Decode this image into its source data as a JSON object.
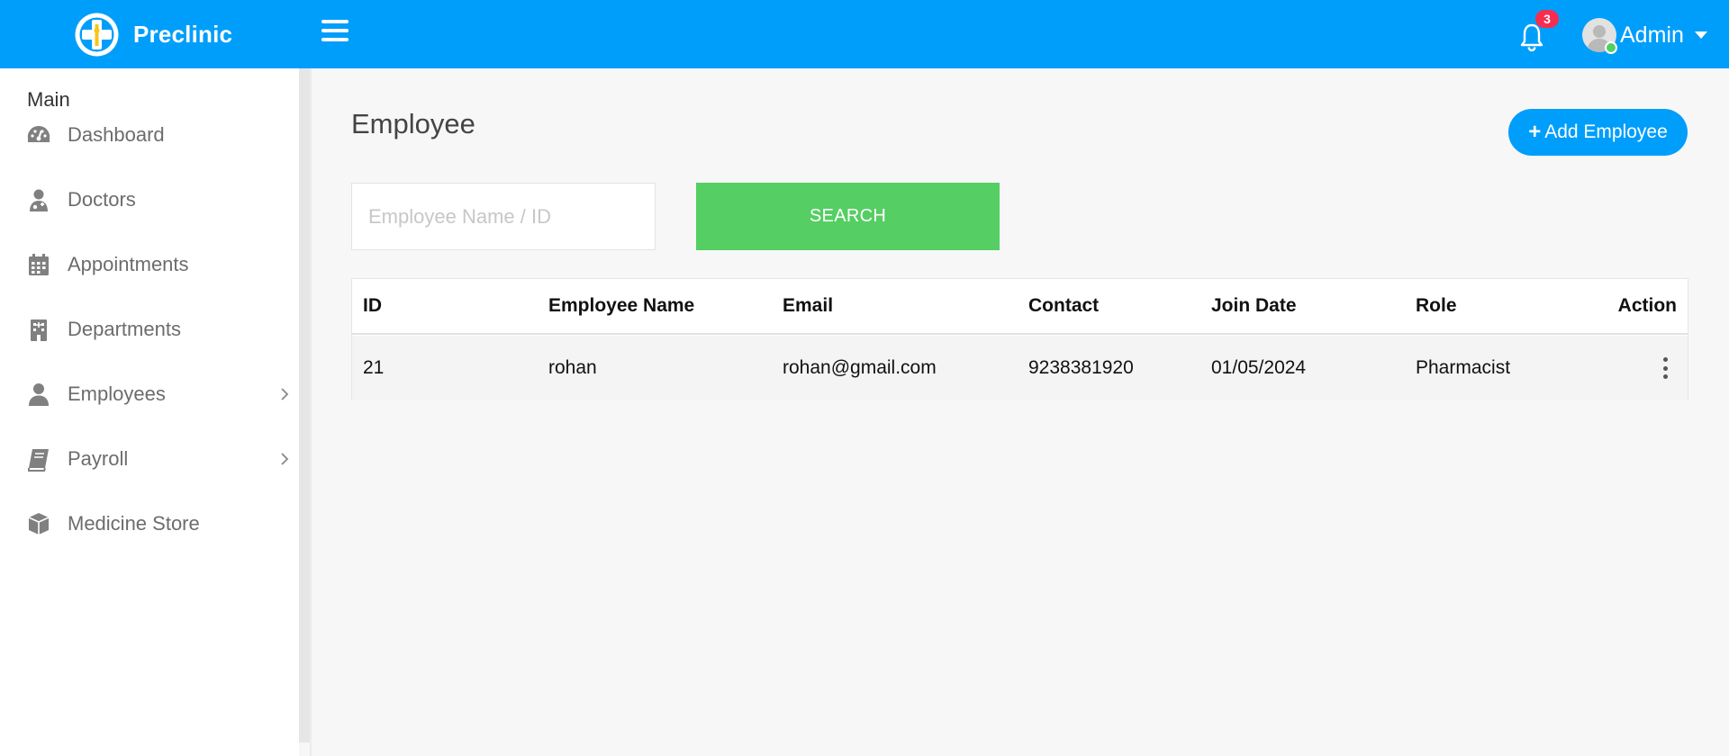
{
  "app": {
    "name": "Preclinic"
  },
  "header": {
    "notification_count": "3",
    "user_name": "Admin",
    "brand_color": "#009efb"
  },
  "sidebar": {
    "title": "Main",
    "items": [
      {
        "label": "Dashboard",
        "icon": "dashboard-icon",
        "has_submenu": false
      },
      {
        "label": "Doctors",
        "icon": "doctor-icon",
        "has_submenu": false
      },
      {
        "label": "Appointments",
        "icon": "calendar-icon",
        "has_submenu": false
      },
      {
        "label": "Departments",
        "icon": "hospital-icon",
        "has_submenu": false
      },
      {
        "label": "Employees",
        "icon": "user-icon",
        "has_submenu": true
      },
      {
        "label": "Payroll",
        "icon": "book-icon",
        "has_submenu": true
      },
      {
        "label": "Medicine Store",
        "icon": "cube-icon",
        "has_submenu": false
      }
    ]
  },
  "main": {
    "title": "Employee",
    "add_button_label": "Add Employee",
    "search": {
      "placeholder": "Employee Name / ID",
      "value": "",
      "button_label": "SEARCH"
    },
    "table": {
      "headers": {
        "id": "ID",
        "name": "Employee Name",
        "email": "Email",
        "contact": "Contact",
        "join_date": "Join Date",
        "role": "Role",
        "action": "Action"
      },
      "rows": [
        {
          "id": "21",
          "name": "rohan",
          "email": "rohan@gmail.com",
          "contact": "9238381920",
          "join_date": "01/05/2024",
          "role": "Pharmacist"
        }
      ]
    }
  },
  "colors": {
    "success": "#55ce63",
    "danger": "#f62d51"
  }
}
